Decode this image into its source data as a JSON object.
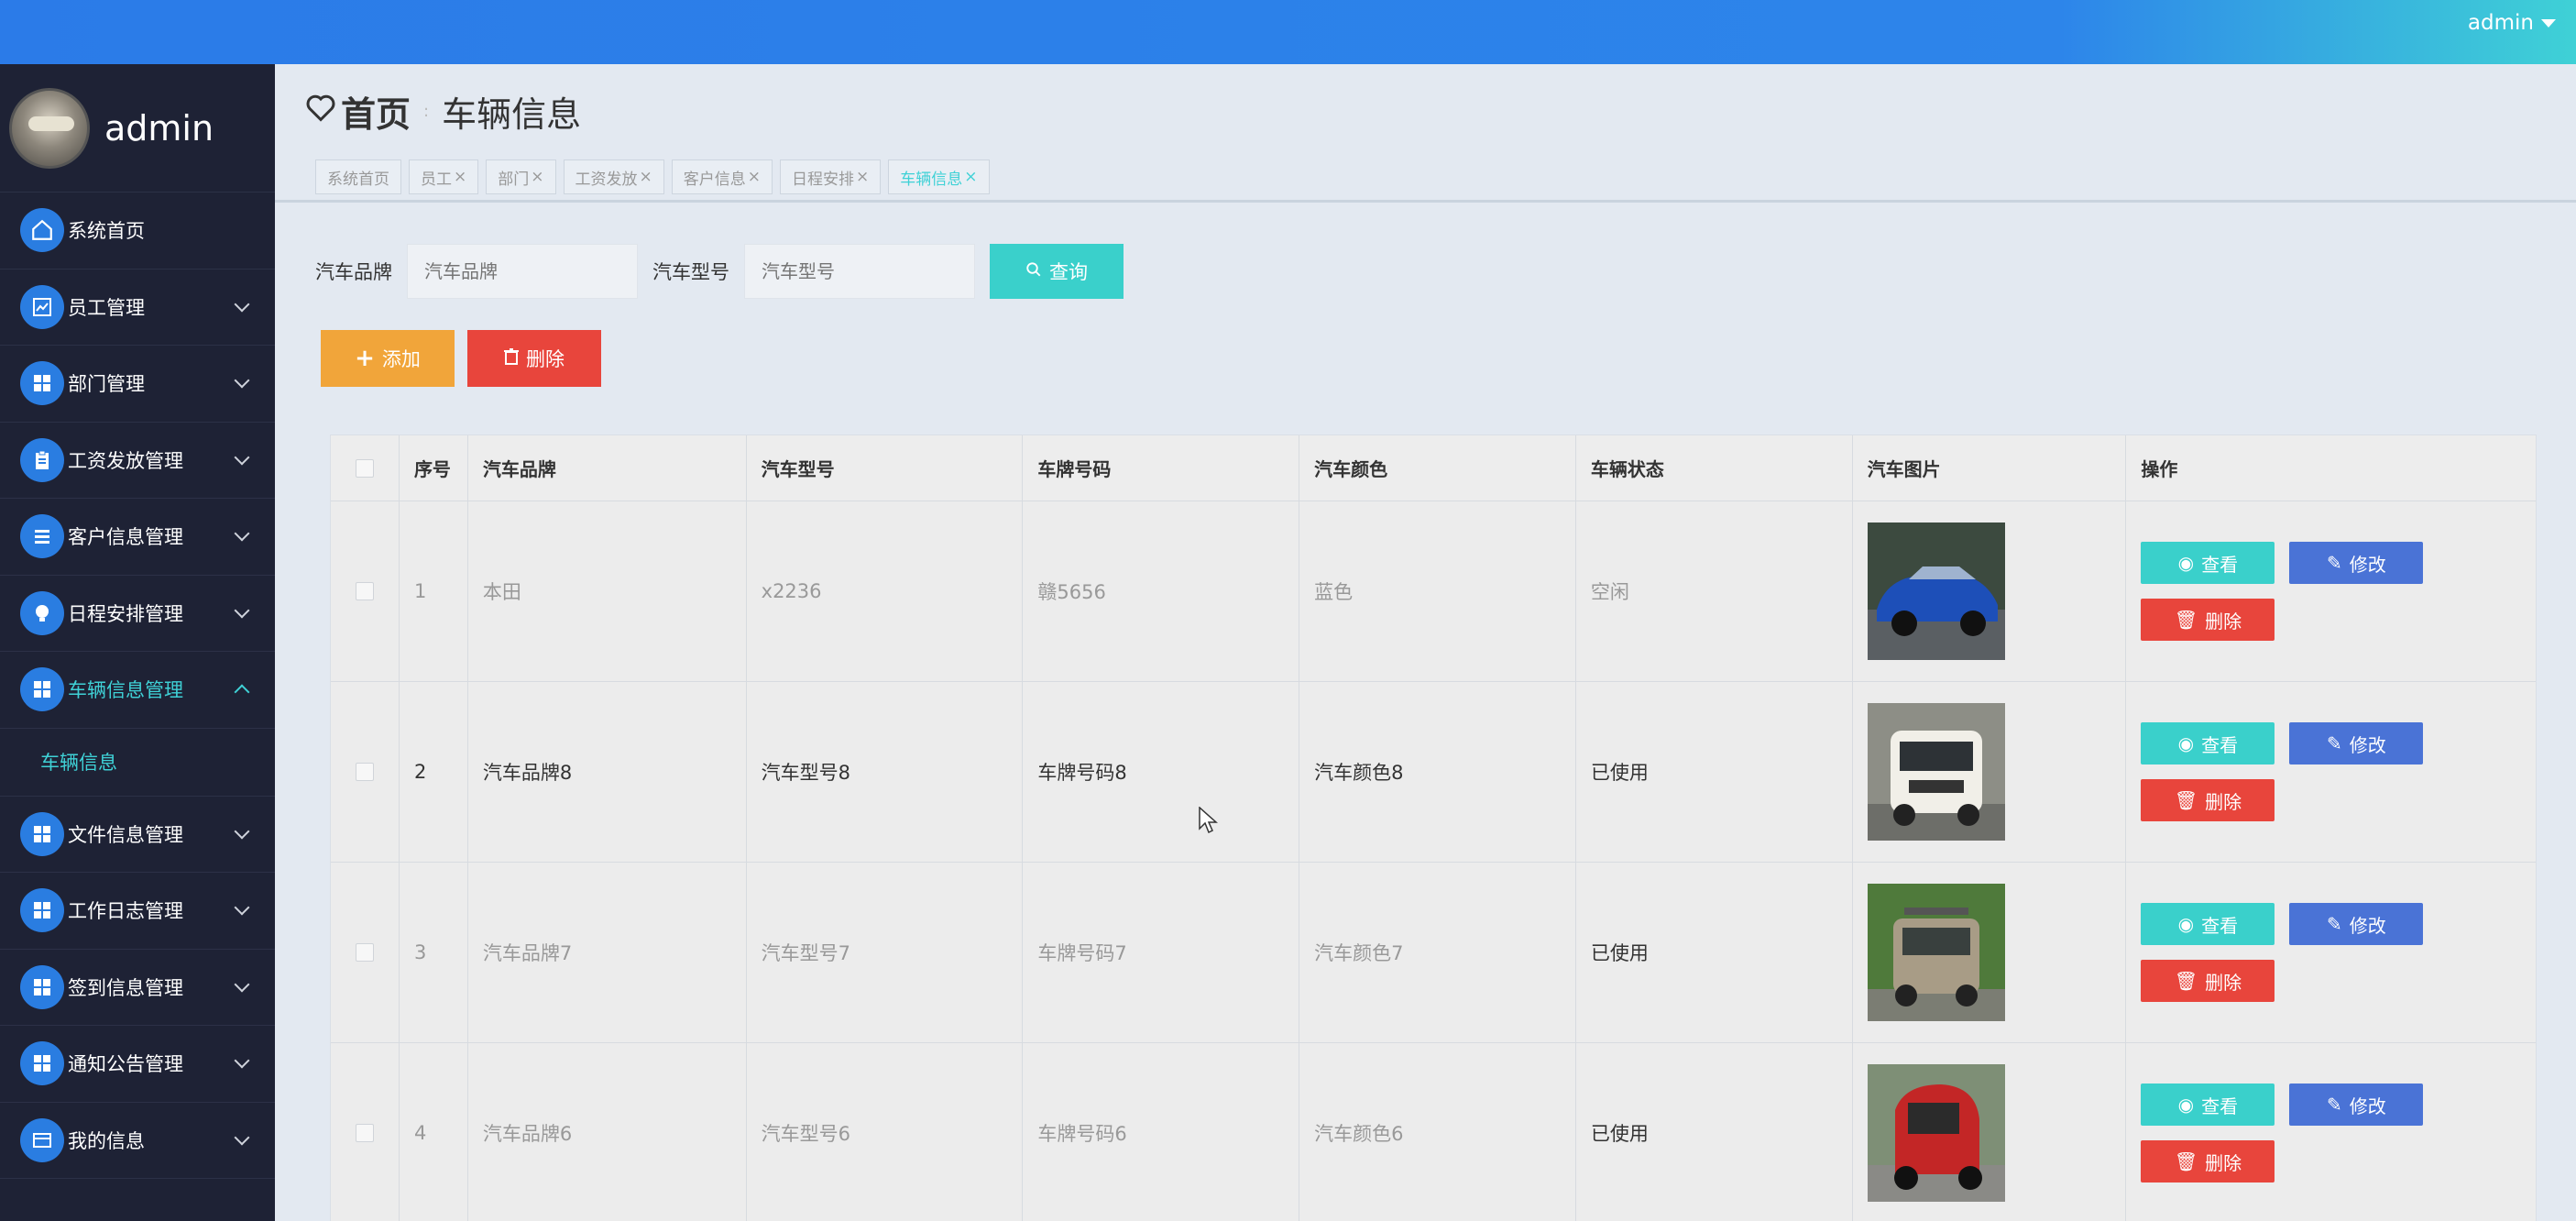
{
  "header": {
    "user": "admin"
  },
  "sidebar": {
    "username": "admin",
    "items": [
      {
        "label": "系统首页",
        "icon": "home-icon",
        "expandable": false
      },
      {
        "label": "员工管理",
        "icon": "chart-icon",
        "expandable": true
      },
      {
        "label": "部门管理",
        "icon": "grid-icon",
        "expandable": true
      },
      {
        "label": "工资发放管理",
        "icon": "clipboard-icon",
        "expandable": true
      },
      {
        "label": "客户信息管理",
        "icon": "list-icon",
        "expandable": true
      },
      {
        "label": "日程安排管理",
        "icon": "bulb-icon",
        "expandable": true
      },
      {
        "label": "车辆信息管理",
        "icon": "grid-icon",
        "expandable": true,
        "active": true
      },
      {
        "label": "文件信息管理",
        "icon": "grid-icon",
        "expandable": true
      },
      {
        "label": "工作日志管理",
        "icon": "grid-icon",
        "expandable": true
      },
      {
        "label": "签到信息管理",
        "icon": "grid-icon",
        "expandable": true
      },
      {
        "label": "通知公告管理",
        "icon": "grid-icon",
        "expandable": true
      },
      {
        "label": "我的信息",
        "icon": "card-icon",
        "expandable": true
      }
    ],
    "sub_item": "车辆信息"
  },
  "breadcrumb": {
    "home": "首页",
    "current": "车辆信息"
  },
  "tabs": [
    "系统首页",
    "员工",
    "部门",
    "工资发放",
    "客户信息",
    "日程安排",
    "车辆信息"
  ],
  "search": {
    "brand_label": "汽车品牌",
    "brand_placeholder": "汽车品牌",
    "model_label": "汽车型号",
    "model_placeholder": "汽车型号",
    "query_label": "查询"
  },
  "toolbar": {
    "add_label": "添加",
    "delete_label": "删除"
  },
  "table": {
    "columns": [
      "序号",
      "汽车品牌",
      "汽车型号",
      "车牌号码",
      "汽车颜色",
      "车辆状态",
      "汽车图片",
      "操作"
    ],
    "rows": [
      {
        "no": "1",
        "brand": "本田",
        "model": "x2236",
        "plate": "赣5656",
        "color": "蓝色",
        "status": "空闲"
      },
      {
        "no": "2",
        "brand": "汽车品牌8",
        "model": "汽车型号8",
        "plate": "车牌号码8",
        "color": "汽车颜色8",
        "status": "已使用"
      },
      {
        "no": "3",
        "brand": "汽车品牌7",
        "model": "汽车型号7",
        "plate": "车牌号码7",
        "color": "汽车颜色7",
        "status": "已使用"
      },
      {
        "no": "4",
        "brand": "汽车品牌6",
        "model": "汽车型号6",
        "plate": "车牌号码6",
        "color": "汽车颜色6",
        "status": "已使用"
      }
    ],
    "row_actions": {
      "view": "查看",
      "edit": "修改",
      "delete": "删除"
    }
  },
  "colors": {
    "accent": "#3ad0cb",
    "primary": "#2b7be8",
    "danger": "#e8453c",
    "warning": "#f1a53a",
    "edit": "#4a73d6"
  }
}
